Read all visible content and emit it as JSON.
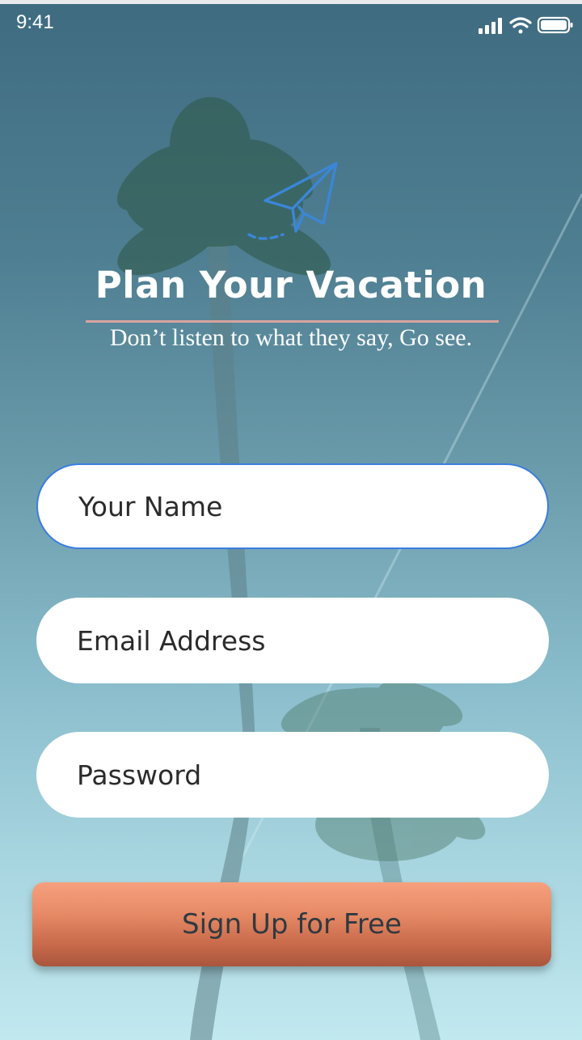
{
  "status_bar": {
    "time": "9:41",
    "icons": [
      "cellular-signal-icon",
      "wifi-icon",
      "battery-icon"
    ]
  },
  "header": {
    "logo_icon": "paper-plane-icon",
    "title": "Plan Your Vacation",
    "subtitle": "Don’t listen to what they say, Go see."
  },
  "form": {
    "name_placeholder": "Your Name",
    "email_placeholder": "Email Address",
    "password_placeholder": "Password",
    "submit_label": "Sign Up for Free"
  },
  "colors": {
    "accent": "#3a7de0",
    "button_top": "#f6a07e",
    "button_bottom": "#a9563d",
    "divider": "#d8a3a0"
  }
}
